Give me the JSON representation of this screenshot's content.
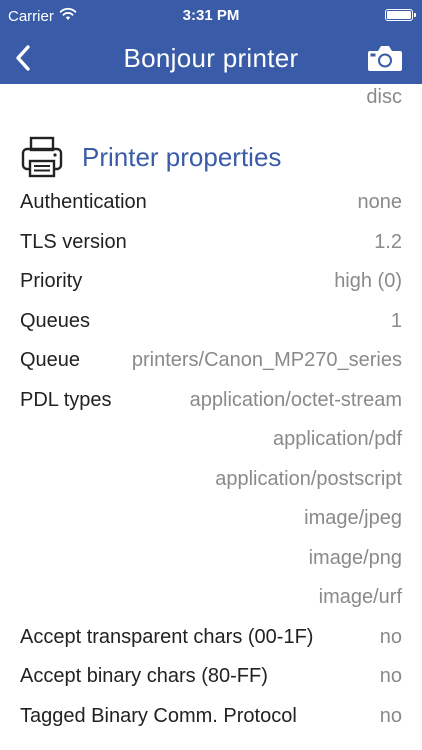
{
  "status_bar": {
    "carrier": "Carrier",
    "time": "3:31 PM"
  },
  "nav": {
    "title": "Bonjour printer"
  },
  "top_value": "disc",
  "section": {
    "title": "Printer properties"
  },
  "properties": [
    {
      "label": "Authentication",
      "value": "none"
    },
    {
      "label": "TLS version",
      "value": "1.2"
    },
    {
      "label": "Priority",
      "value": "high (0)"
    },
    {
      "label": "Queues",
      "value": "1"
    },
    {
      "label": "Queue",
      "value": "printers/Canon_MP270_series"
    },
    {
      "label": "PDL types",
      "value": "application/octet-stream"
    },
    {
      "label": "",
      "value": "application/pdf"
    },
    {
      "label": "",
      "value": "application/postscript"
    },
    {
      "label": "",
      "value": "image/jpeg"
    },
    {
      "label": "",
      "value": "image/png"
    },
    {
      "label": "",
      "value": "image/urf"
    },
    {
      "label": "Accept transparent chars (00-1F)",
      "value": "no"
    },
    {
      "label": "Accept binary chars (80-FF)",
      "value": "no"
    },
    {
      "label": "Tagged Binary Comm. Protocol",
      "value": "no"
    }
  ],
  "colors": {
    "accent": "#3a5ca8",
    "label_text": "#222222",
    "value_text": "#8a8a8a"
  },
  "icons": {
    "wifi": "wifi-icon",
    "battery": "battery-icon",
    "back": "chevron-left-icon",
    "camera": "camera-icon",
    "printer": "printer-icon"
  }
}
